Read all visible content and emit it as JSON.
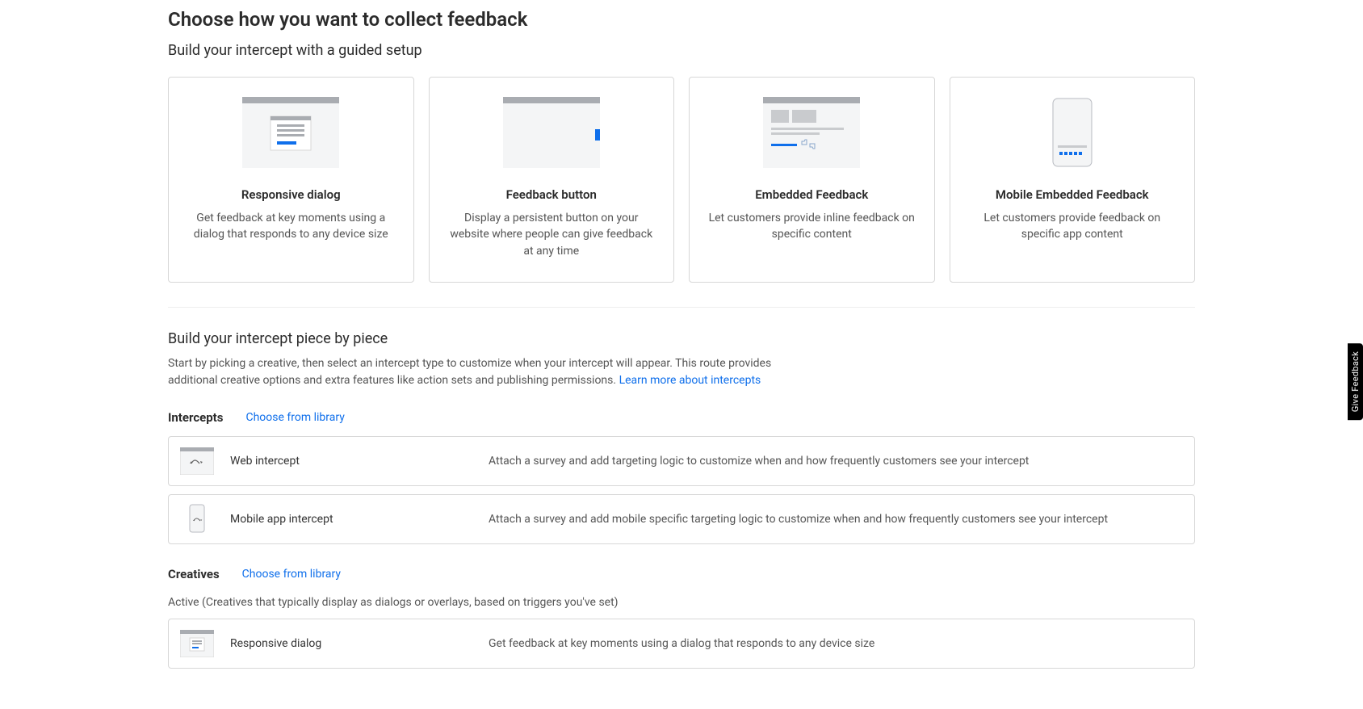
{
  "heading": "Choose how you want to collect feedback",
  "guided": {
    "subtitle": "Build your intercept with a guided setup",
    "cards": [
      {
        "title": "Responsive dialog",
        "desc": "Get feedback at key moments using a dialog that responds to any device size"
      },
      {
        "title": "Feedback button",
        "desc": "Display a persistent button on your website where people can give feedback at any time"
      },
      {
        "title": "Embedded Feedback",
        "desc": "Let customers provide inline feedback on specific content"
      },
      {
        "title": "Mobile Embedded Feedback",
        "desc": "Let customers provide feedback on specific app content"
      }
    ]
  },
  "piece": {
    "title": "Build your intercept piece by piece",
    "desc": "Start by picking a creative, then select an intercept type to customize when your intercept will appear. This route provides additional creative options and extra features like action sets and publishing permissions. ",
    "learn_more": "Learn more about intercepts"
  },
  "intercepts": {
    "label": "Intercepts",
    "choose": "Choose from library",
    "rows": [
      {
        "title": "Web intercept",
        "desc": "Attach a survey and add targeting logic to customize when and how frequently customers see your intercept"
      },
      {
        "title": "Mobile app intercept",
        "desc": "Attach a survey and add mobile specific targeting logic to customize when and how frequently customers see your intercept"
      }
    ]
  },
  "creatives": {
    "label": "Creatives",
    "choose": "Choose from library",
    "note": "Active (Creatives that typically display as dialogs or overlays, based on triggers you've set)",
    "rows": [
      {
        "title": "Responsive dialog",
        "desc": "Get feedback at key moments using a dialog that responds to any device size"
      }
    ]
  },
  "feedback_tab": "Give Feedback"
}
